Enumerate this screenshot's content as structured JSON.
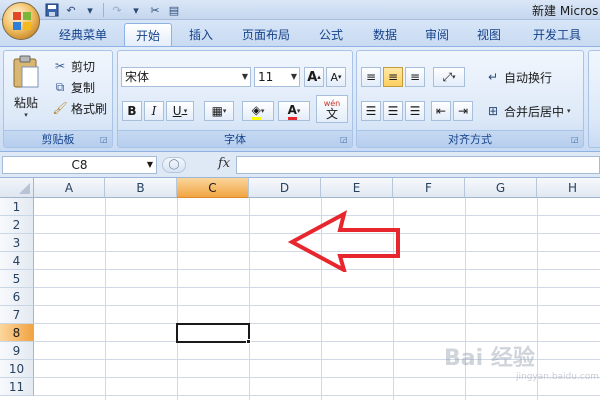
{
  "window": {
    "title": "新建 Micros"
  },
  "tabs": [
    {
      "label": "经典菜单"
    },
    {
      "label": "开始"
    },
    {
      "label": "插入"
    },
    {
      "label": "页面布局"
    },
    {
      "label": "公式"
    },
    {
      "label": "数据"
    },
    {
      "label": "审阅"
    },
    {
      "label": "视图"
    },
    {
      "label": "开发工具"
    }
  ],
  "clipboard": {
    "group_label": "剪贴板",
    "paste": "粘贴",
    "cut": "剪切",
    "copy": "复制",
    "format_painter": "格式刷"
  },
  "font": {
    "group_label": "字体",
    "font_name": "宋体",
    "font_size": "11",
    "grow": "A",
    "shrink": "A",
    "bold": "B",
    "italic": "I",
    "underline": "U",
    "font_color_glyph": "A",
    "wen": "wén",
    "wen_char": "文"
  },
  "alignment": {
    "group_label": "对齐方式",
    "wrap_text": "自动换行",
    "merge_center": "合并后居中"
  },
  "formula_bar": {
    "name_box": "C8",
    "fx": "fx",
    "value": ""
  },
  "grid": {
    "columns": [
      "A",
      "B",
      "C",
      "D",
      "E",
      "F",
      "G",
      "H"
    ],
    "rows": [
      "1",
      "2",
      "3",
      "4",
      "5",
      "6",
      "7",
      "8",
      "9",
      "10",
      "11"
    ],
    "selected_column": "C",
    "selected_row": "8"
  },
  "annotation": {
    "color": "#e8262d"
  },
  "watermark": {
    "text": "Bai 经验",
    "sub": "jingyan.baidu.com"
  },
  "colors": {
    "accent": "#15428b",
    "selection": "#f1a443",
    "ribbon": "#dae7f8"
  }
}
